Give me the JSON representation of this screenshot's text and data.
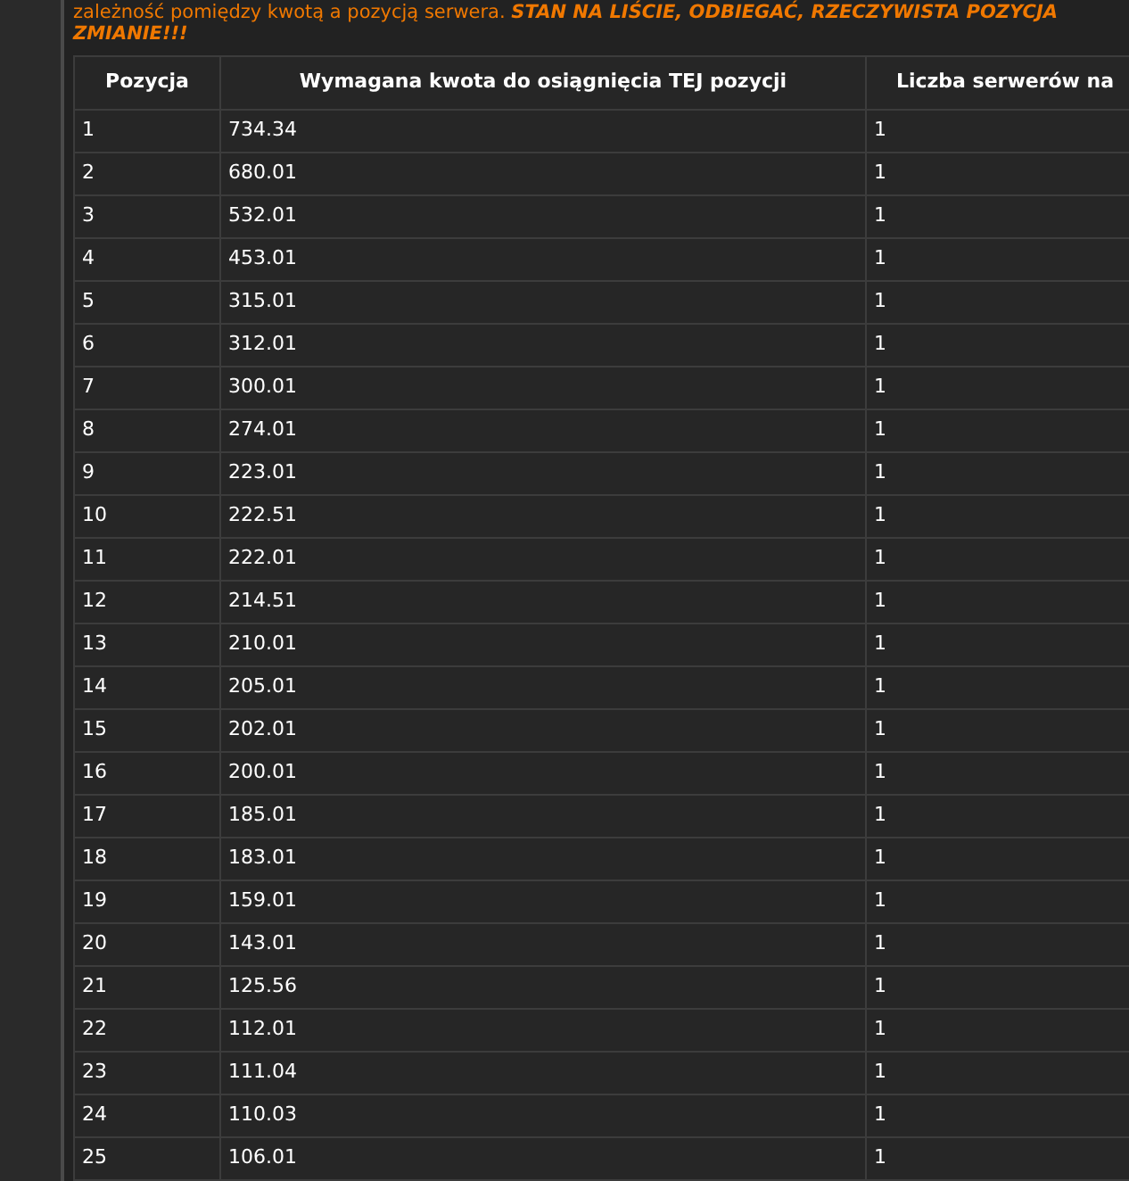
{
  "notice": {
    "line_1": "zależność pomiędzy kwotą a pozycją serwera. **STAN NA LIŚCIE, ODBIEGAĆ, RZECZYWISTA POZYCJA**",
    "line_2": "ZMIANIE!!!"
  },
  "table": {
    "columns": [
      "Pozycja",
      "Wymagana kwota do osiągnięcia TEJ pozycji",
      "Liczba serwerów na"
    ],
    "rows": [
      [
        "1",
        "734.34",
        "1"
      ],
      [
        "2",
        "680.01",
        "1"
      ],
      [
        "3",
        "532.01",
        "1"
      ],
      [
        "4",
        "453.01",
        "1"
      ],
      [
        "5",
        "315.01",
        "1"
      ],
      [
        "6",
        "312.01",
        "1"
      ],
      [
        "7",
        "300.01",
        "1"
      ],
      [
        "8",
        "274.01",
        "1"
      ],
      [
        "9",
        "223.01",
        "1"
      ],
      [
        "10",
        "222.51",
        "1"
      ],
      [
        "11",
        "222.01",
        "1"
      ],
      [
        "12",
        "214.51",
        "1"
      ],
      [
        "13",
        "210.01",
        "1"
      ],
      [
        "14",
        "205.01",
        "1"
      ],
      [
        "15",
        "202.01",
        "1"
      ],
      [
        "16",
        "200.01",
        "1"
      ],
      [
        "17",
        "185.01",
        "1"
      ],
      [
        "18",
        "183.01",
        "1"
      ],
      [
        "19",
        "159.01",
        "1"
      ],
      [
        "20",
        "143.01",
        "1"
      ],
      [
        "21",
        "125.56",
        "1"
      ],
      [
        "22",
        "112.01",
        "1"
      ],
      [
        "23",
        "111.04",
        "1"
      ],
      [
        "24",
        "110.03",
        "1"
      ],
      [
        "25",
        "106.01",
        "1"
      ]
    ]
  }
}
